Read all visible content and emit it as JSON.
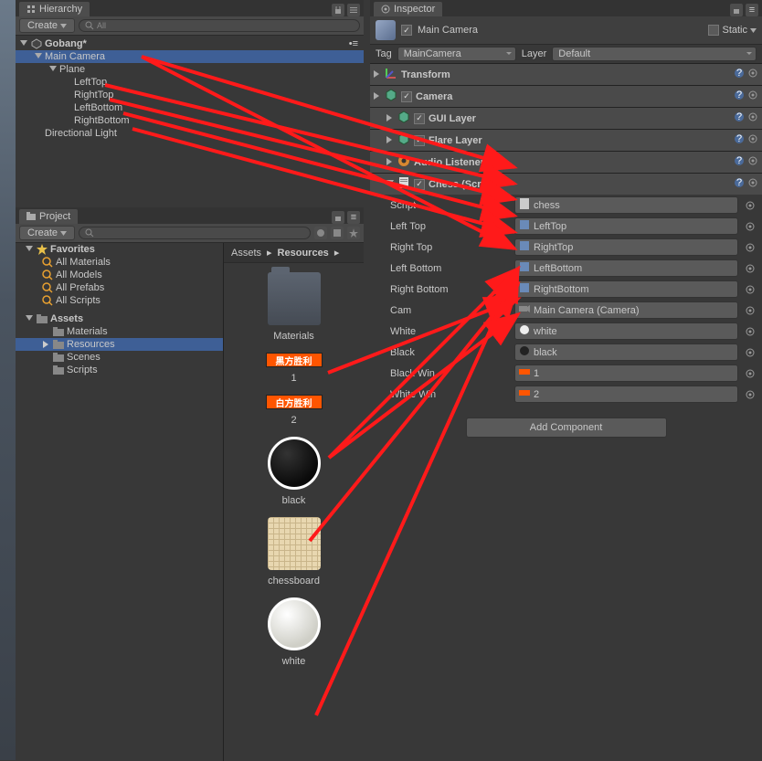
{
  "hierarchy": {
    "tab": "Hierarchy",
    "create": "Create",
    "search_placeholder": "All",
    "root": "Gobang*",
    "items": [
      {
        "name": "Main Camera",
        "indent": 1,
        "foldout": true,
        "selected": true
      },
      {
        "name": "Plane",
        "indent": 2,
        "foldout": true
      },
      {
        "name": "LeftTop",
        "indent": 3
      },
      {
        "name": "RightTop",
        "indent": 3
      },
      {
        "name": "LeftBottom",
        "indent": 3
      },
      {
        "name": "RightBottom",
        "indent": 3
      },
      {
        "name": "Directional Light",
        "indent": 1
      }
    ]
  },
  "project": {
    "tab": "Project",
    "create": "Create",
    "favorites": "Favorites",
    "fav_items": [
      "All Materials",
      "All Models",
      "All Prefabs",
      "All Scripts"
    ],
    "assets": "Assets",
    "asset_folders": [
      {
        "name": "Materials",
        "selected": false
      },
      {
        "name": "Resources",
        "selected": true
      },
      {
        "name": "Scenes",
        "selected": false
      },
      {
        "name": "Scripts",
        "selected": false
      }
    ],
    "breadcrumb": [
      "Assets",
      "Resources"
    ],
    "grid": [
      {
        "name": "Materials",
        "type": "folder"
      },
      {
        "name": "1",
        "type": "orange",
        "tag": "黑方胜利"
      },
      {
        "name": "2",
        "type": "orange",
        "tag": "白方胜利"
      },
      {
        "name": "black",
        "type": "sphere-black"
      },
      {
        "name": "chessboard",
        "type": "board"
      },
      {
        "name": "white",
        "type": "sphere-white"
      }
    ]
  },
  "inspector": {
    "tab": "Inspector",
    "object_name": "Main Camera",
    "static_label": "Static",
    "tag_label": "Tag",
    "tag_value": "MainCamera",
    "layer_label": "Layer",
    "layer_value": "Default",
    "components": [
      {
        "name": "Transform",
        "checkbox": false,
        "expanded": false
      },
      {
        "name": "Camera",
        "checkbox": true,
        "expanded": false
      },
      {
        "name": "GUI Layer",
        "checkbox": true,
        "expanded": false,
        "indent": true
      },
      {
        "name": "Flare Layer",
        "checkbox": true,
        "expanded": false,
        "indent": true
      },
      {
        "name": "Audio Listener",
        "checkbox": false,
        "expanded": false,
        "indent": true,
        "icon": "audio"
      },
      {
        "name": "Chess (Script)",
        "checkbox": true,
        "expanded": true,
        "indent": true,
        "icon": "script"
      }
    ],
    "chess_props": [
      {
        "label": "Script",
        "value": "chess",
        "icon": "script"
      },
      {
        "label": "Left Top",
        "value": "LeftTop",
        "icon": "prefab"
      },
      {
        "label": "Right Top",
        "value": "RightTop",
        "icon": "prefab"
      },
      {
        "label": "Left Bottom",
        "value": "LeftBottom",
        "icon": "prefab"
      },
      {
        "label": "Right Bottom",
        "value": "RightBottom",
        "icon": "prefab"
      },
      {
        "label": "Cam",
        "value": "Main Camera (Camera)",
        "icon": "camera"
      },
      {
        "label": "White",
        "value": "white",
        "icon": "sphere-white"
      },
      {
        "label": "Black",
        "value": "black",
        "icon": "sphere-black"
      },
      {
        "label": "Black Win",
        "value": "1",
        "icon": "orange"
      },
      {
        "label": "White Win",
        "value": "2",
        "icon": "orange"
      }
    ],
    "add_component": "Add Component"
  }
}
